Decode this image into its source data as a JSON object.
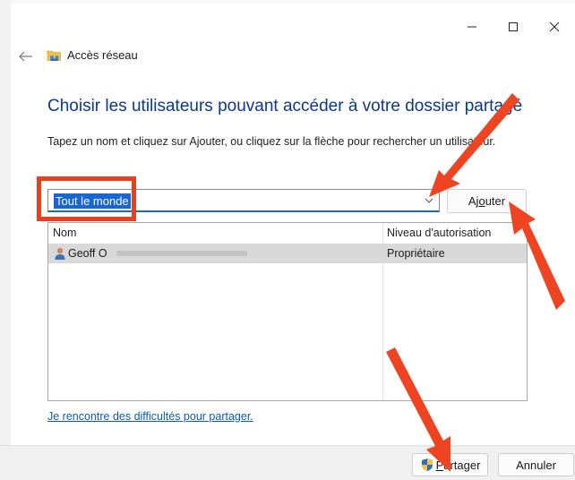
{
  "window": {
    "title": "Accès réseau",
    "controls": {
      "minimize": "minimize-icon",
      "maximize": "maximize-icon",
      "close": "close-icon"
    }
  },
  "main": {
    "heading": "Choisir les utilisateurs pouvant accéder à votre dossier partagé",
    "instruction": "Tapez un nom et cliquez sur Ajouter, ou cliquez sur la flèche pour rechercher un utilisateur.",
    "combo": {
      "value": "Tout le monde"
    },
    "add_button": {
      "before": "Aj",
      "underline": "o",
      "after": "uter"
    },
    "table": {
      "columns": [
        "Nom",
        "Niveau d'autorisation"
      ],
      "rows": [
        {
          "name": "Geoff O",
          "level": "Propriétaire"
        }
      ]
    },
    "help_link": "Je rencontre des difficultés pour partager."
  },
  "footer": {
    "share_button": {
      "underline": "P",
      "after": "artager"
    },
    "cancel_button": "Annuler"
  },
  "colors": {
    "heading": "#0b3a8a",
    "selection": "#1766d1",
    "link": "#0b5cb8",
    "annotation": "#e8401e"
  }
}
